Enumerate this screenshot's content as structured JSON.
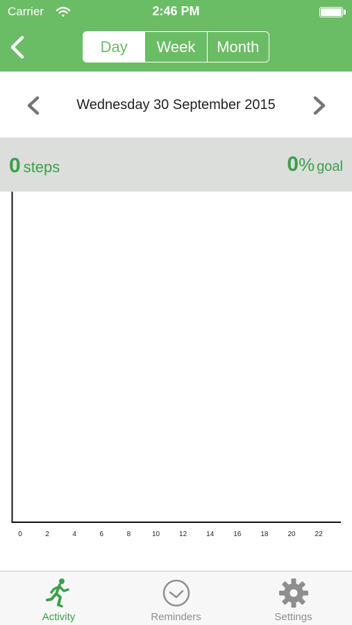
{
  "status_bar": {
    "carrier": "Carrier",
    "time": "2:46 PM"
  },
  "header": {
    "tabs": [
      {
        "label": "Day",
        "active": true
      },
      {
        "label": "Week",
        "active": false
      },
      {
        "label": "Month",
        "active": false
      }
    ],
    "accent_color": "#6abd64"
  },
  "date_nav": {
    "date": "Wednesday 30 September 2015"
  },
  "summary": {
    "steps_value": "0",
    "steps_unit": "steps",
    "goal_value": "0",
    "goal_percent_sign": "%",
    "goal_unit": "goal",
    "text_color": "#3aa04a"
  },
  "chart_data": {
    "type": "bar",
    "x_ticks": [
      "0",
      "2",
      "4",
      "6",
      "8",
      "10",
      "12",
      "14",
      "16",
      "18",
      "20",
      "22"
    ],
    "values": [],
    "title": "",
    "xlabel": "",
    "ylabel": ""
  },
  "tabbar": {
    "items": [
      {
        "label": "Activity",
        "icon": "runner-icon",
        "active": true
      },
      {
        "label": "Reminders",
        "icon": "clock-icon",
        "active": false
      },
      {
        "label": "Settings",
        "icon": "gear-icon",
        "active": false
      }
    ]
  }
}
